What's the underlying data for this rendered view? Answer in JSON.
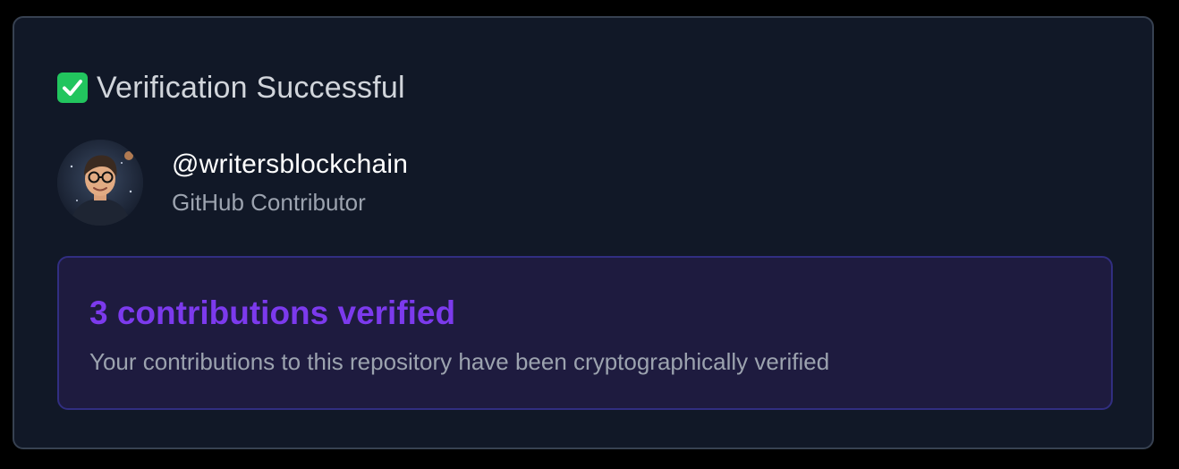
{
  "verification": {
    "status_icon": "check-mark-button-icon",
    "title": "Verification Successful"
  },
  "profile": {
    "avatar_icon": "user-avatar",
    "username": "@writersblockchain",
    "role": "GitHub Contributor"
  },
  "contributions": {
    "heading": "3 contributions verified",
    "description": "Your contributions to this repository have been cryptographically verified"
  },
  "colors": {
    "background": "#000000",
    "card_background": "#111827",
    "card_border": "#374151",
    "success_green": "#22c55e",
    "accent_purple": "#7c3aed",
    "info_box_background": "#1e1b3f",
    "info_box_border": "#312e81",
    "muted_text": "#9ca3af"
  }
}
